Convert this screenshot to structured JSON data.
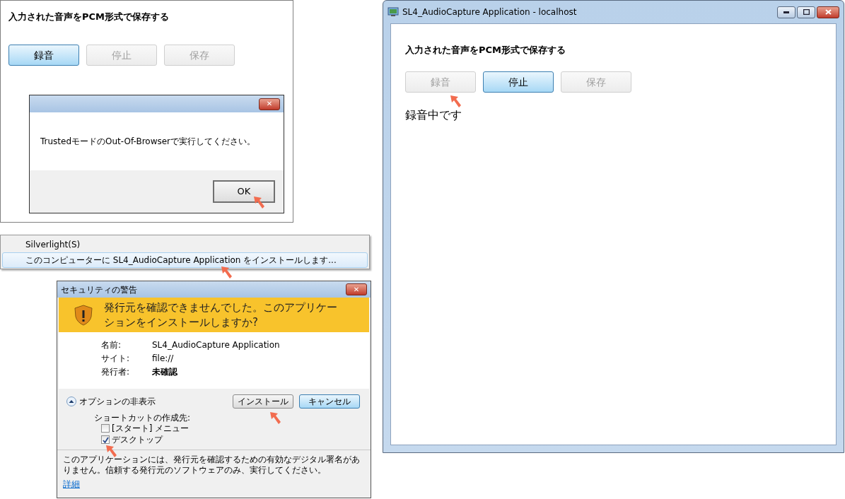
{
  "main_app": {
    "heading": "入力された音声をPCM形式で保存する",
    "buttons": [
      {
        "label": "録音",
        "disabled": false,
        "highlighted": true
      },
      {
        "label": "停止",
        "disabled": true,
        "highlighted": false
      },
      {
        "label": "保存",
        "disabled": true,
        "highlighted": false
      }
    ]
  },
  "error_dialog": {
    "close": "✕",
    "message": "TrustedモードのOut-Of-Browserで実行してください。",
    "ok_button": "OK"
  },
  "context_menu": {
    "items": [
      {
        "label": "Silverlight(S)",
        "selected": false
      },
      {
        "label": "このコンピューターに SL4_AudioCapture Application をインストールします...",
        "selected": true
      }
    ]
  },
  "security_dialog": {
    "title": "セキュリティの警告",
    "close": "✕",
    "warning": "発行元を確認できませんでした。このアプリケーションをインストールしますか?",
    "fields": [
      {
        "label": "名前:",
        "value": "SL4_AudioCapture Application",
        "emphasized": false
      },
      {
        "label": "サイト:",
        "value": "file://",
        "emphasized": false
      },
      {
        "label": "発行者:",
        "value": "未確認",
        "emphasized": true
      }
    ],
    "options_toggle": {
      "label": "オプションの非表示",
      "expanded": true
    },
    "buttons": [
      {
        "label": "インストール",
        "highlighted": false
      },
      {
        "label": "キャンセル",
        "highlighted": true
      }
    ],
    "shortcut_label": "ショートカットの作成先:",
    "shortcuts": [
      {
        "label": "[スタート] メニュー",
        "checked": false
      },
      {
        "label": "デスクトップ",
        "checked": true
      }
    ],
    "footnote": "このアプリケーションには、発行元を確認するための有効なデジタル署名がありません。信頼する発行元のソフトウェアのみ、実行してください。",
    "details_link": "詳細"
  },
  "app_window": {
    "title": "SL4_AudioCapture Application - localhost",
    "heading": "入力された音声をPCM形式で保存する",
    "buttons": [
      {
        "label": "録音",
        "disabled": true,
        "highlighted": false
      },
      {
        "label": "停止",
        "disabled": false,
        "highlighted": true
      },
      {
        "label": "保存",
        "disabled": true,
        "highlighted": false
      }
    ],
    "status": "録音中です"
  }
}
